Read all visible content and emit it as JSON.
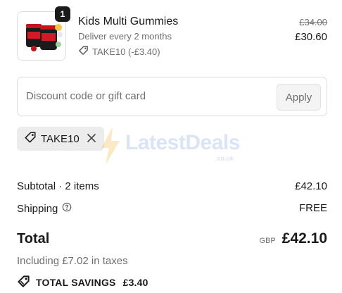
{
  "product": {
    "quantity": "1",
    "title": "Kids Multi Gummies",
    "subscription": "Deliver every 2 months",
    "discount_line": "TAKE10 (-£3.40)",
    "original_price": "£34.00",
    "price": "£30.60",
    "tag_icon": "tag-icon"
  },
  "discount": {
    "placeholder": "Discount code or gift card",
    "apply_label": "Apply"
  },
  "applied_code": {
    "code": "TAKE10",
    "remove_icon": "close-icon"
  },
  "summary": {
    "subtotal_label": "Subtotal · 2 items",
    "subtotal_value": "£42.10",
    "shipping_label": "Shipping",
    "shipping_value": "FREE",
    "total_label": "Total",
    "currency": "GBP",
    "total_value": "£42.10",
    "taxes_note": "Including £7.02 in taxes",
    "savings_label": "TOTAL SAVINGS",
    "savings_value": "£3.40"
  },
  "watermark": {
    "text": "LatestDeals",
    "sub": ".co.uk"
  },
  "colors": {
    "text": "#1a1a1a",
    "muted": "#707070",
    "border": "#dedede",
    "chip": "#ececec"
  }
}
